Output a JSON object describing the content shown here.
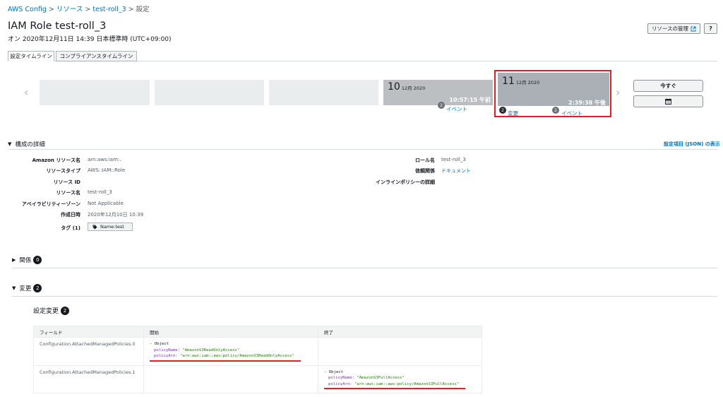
{
  "breadcrumb": {
    "items": [
      "AWS Config",
      "リソース",
      "test-roll_3"
    ],
    "current": "設定"
  },
  "header": {
    "title": "IAM Role test-roll_3",
    "subtitle": "オン 2020年12月11日 14:39 日本標準時 (UTC+09:00)",
    "manage_label": "リソースの管理",
    "help_label": "?"
  },
  "tabs": [
    {
      "label": "設定タイムライン",
      "active": true
    },
    {
      "label": "コンプライアンスタイムライン",
      "active": false
    }
  ],
  "timeline": {
    "cards": [
      {
        "day": "10",
        "month": "12月 2020",
        "time": "10:57:15 午前",
        "events_count": "2",
        "events_label": "イベント"
      },
      {
        "day": "11",
        "month": "12月 2020",
        "time": "2:39:38 午後",
        "changes_count": "2",
        "changes_label": "変更",
        "events_count": "2",
        "events_label": "イベント",
        "selected": true
      }
    ],
    "now_label": "今すぐ",
    "calendar_icon": "calendar-icon"
  },
  "config_details": {
    "title": "構成の詳細",
    "json_link": "設定項目 (JSON) の表示",
    "left": [
      {
        "label": "Amazon リソース名",
        "value": "arn:aws:iam:."
      },
      {
        "label": "リソースタイプ",
        "value": "AWS::IAM::Role"
      },
      {
        "label": "リソース ID",
        "value": ""
      },
      {
        "label": "リソース名",
        "value": "test-roll_3"
      },
      {
        "label": "アベイラビリティーゾーン",
        "value": "Not Applicable"
      },
      {
        "label": "作成日時",
        "value": "2020年12月10日 10:39"
      }
    ],
    "tags_label": "タグ (1)",
    "tag_value": "Name:test",
    "right": [
      {
        "label": "ロール名",
        "value": "test-roll_3"
      },
      {
        "label": "信頼関係",
        "value": "ドキュメント"
      },
      {
        "label": "インラインポリシーの詳細",
        "value": ""
      }
    ]
  },
  "relations": {
    "title": "関係",
    "count": "0"
  },
  "changes": {
    "title": "変更",
    "count": "2",
    "sub_title": "設定変更",
    "sub_count": "2",
    "columns": [
      "フィールド",
      "開始",
      "終了"
    ],
    "rows": [
      {
        "field": "Configuration.AttachedManagedPolicies.0",
        "start": {
          "object": "- Object",
          "k1": "policyName:",
          "v1": "\"AmazonS3ReadOnlyAccess\"",
          "k2": "policyArn:",
          "v2": "\"arn:aws:iam::aws:policy/AmazonS3ReadOnlyAccess\""
        },
        "end": null
      },
      {
        "field": "Configuration.AttachedManagedPolicies.1",
        "start": null,
        "end": {
          "object": "- Object",
          "k1": "policyName:",
          "v1": "\"AmazonS3FullAccess\"",
          "k2": "policyArn:",
          "v2": "\"arn:aws:iam::aws:policy/AmazonS3FullAccess\""
        }
      }
    ]
  },
  "colors": {
    "accent": "#0073bb",
    "highlight": "#e02020",
    "key": "#7b2cbf",
    "string": "#1d8102"
  }
}
